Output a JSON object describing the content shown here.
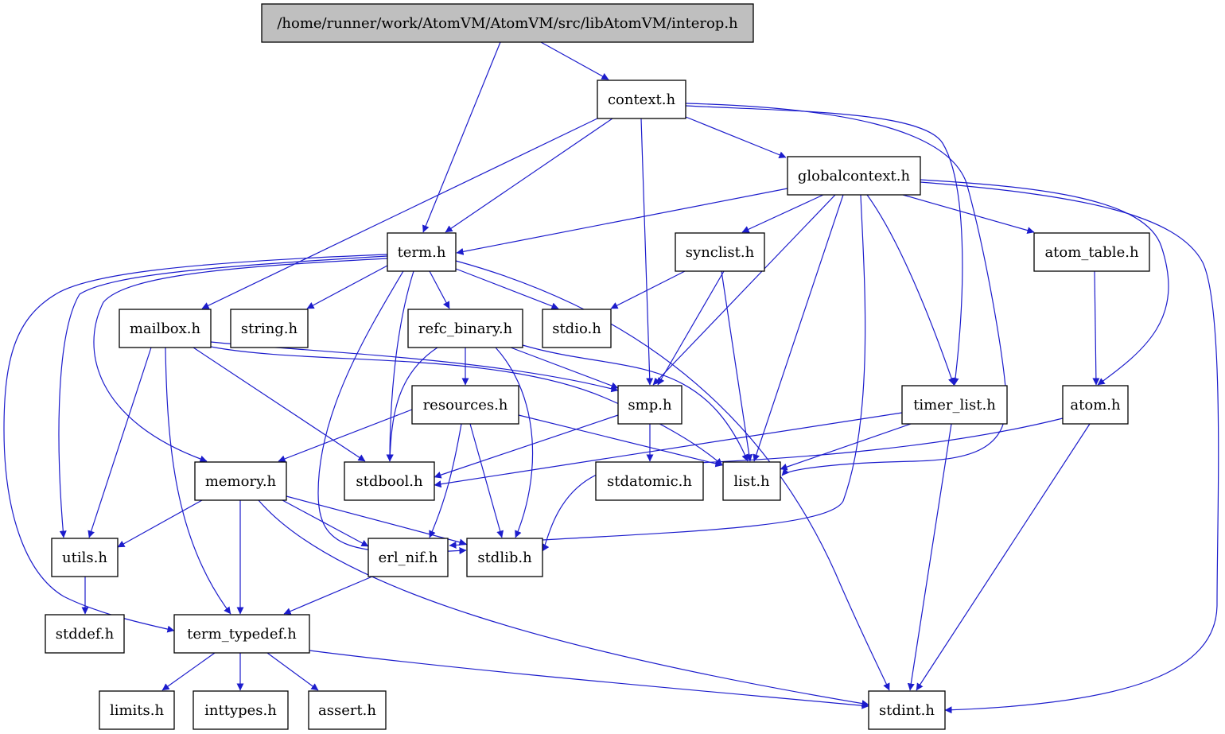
{
  "graph": {
    "type": "include-dependency-graph",
    "edge_color": "#1c1ccc",
    "root_fill": "#bfbfbf",
    "node_fill": "#ffffff",
    "nodes": [
      {
        "id": "interop",
        "label": "/home/runner/work/AtomVM/AtomVM/src/libAtomVM/interop.h",
        "root": true
      },
      {
        "id": "context",
        "label": "context.h"
      },
      {
        "id": "globalcontext",
        "label": "globalcontext.h"
      },
      {
        "id": "term",
        "label": "term.h"
      },
      {
        "id": "synclist",
        "label": "synclist.h"
      },
      {
        "id": "atom_table",
        "label": "atom_table.h"
      },
      {
        "id": "mailbox",
        "label": "mailbox.h"
      },
      {
        "id": "string",
        "label": "string.h"
      },
      {
        "id": "refc_binary",
        "label": "refc_binary.h"
      },
      {
        "id": "stdio",
        "label": "stdio.h"
      },
      {
        "id": "resources",
        "label": "resources.h"
      },
      {
        "id": "smp",
        "label": "smp.h"
      },
      {
        "id": "timer_list",
        "label": "timer_list.h"
      },
      {
        "id": "atom",
        "label": "atom.h"
      },
      {
        "id": "memory",
        "label": "memory.h"
      },
      {
        "id": "stdbool",
        "label": "stdbool.h"
      },
      {
        "id": "stdatomic",
        "label": "stdatomic.h"
      },
      {
        "id": "list",
        "label": "list.h"
      },
      {
        "id": "utils",
        "label": "utils.h"
      },
      {
        "id": "erl_nif",
        "label": "erl_nif.h"
      },
      {
        "id": "stdlib",
        "label": "stdlib.h"
      },
      {
        "id": "stddef",
        "label": "stddef.h"
      },
      {
        "id": "term_typedef",
        "label": "term_typedef.h"
      },
      {
        "id": "limits",
        "label": "limits.h"
      },
      {
        "id": "inttypes",
        "label": "inttypes.h"
      },
      {
        "id": "assert",
        "label": "assert.h"
      },
      {
        "id": "stdint",
        "label": "stdint.h"
      }
    ],
    "edges": [
      [
        "interop",
        "context"
      ],
      [
        "interop",
        "term"
      ],
      [
        "context",
        "globalcontext"
      ],
      [
        "context",
        "term"
      ],
      [
        "context",
        "mailbox"
      ],
      [
        "context",
        "smp"
      ],
      [
        "context",
        "timer_list"
      ],
      [
        "context",
        "list"
      ],
      [
        "globalcontext",
        "term"
      ],
      [
        "globalcontext",
        "synclist"
      ],
      [
        "globalcontext",
        "atom_table"
      ],
      [
        "globalcontext",
        "smp"
      ],
      [
        "globalcontext",
        "list"
      ],
      [
        "globalcontext",
        "erl_nif"
      ],
      [
        "globalcontext",
        "timer_list"
      ],
      [
        "globalcontext",
        "atom"
      ],
      [
        "globalcontext",
        "stdint"
      ],
      [
        "term",
        "string"
      ],
      [
        "term",
        "refc_binary"
      ],
      [
        "term",
        "stdio"
      ],
      [
        "term",
        "stdbool"
      ],
      [
        "term",
        "stdlib"
      ],
      [
        "term",
        "stdint"
      ],
      [
        "term",
        "memory"
      ],
      [
        "term",
        "utils"
      ],
      [
        "term",
        "term_typedef"
      ],
      [
        "synclist",
        "stdio"
      ],
      [
        "synclist",
        "smp"
      ],
      [
        "synclist",
        "list"
      ],
      [
        "atom_table",
        "atom"
      ],
      [
        "mailbox",
        "smp"
      ],
      [
        "mailbox",
        "list"
      ],
      [
        "mailbox",
        "stdbool"
      ],
      [
        "mailbox",
        "utils"
      ],
      [
        "mailbox",
        "term_typedef"
      ],
      [
        "refc_binary",
        "resources"
      ],
      [
        "refc_binary",
        "smp"
      ],
      [
        "refc_binary",
        "list"
      ],
      [
        "refc_binary",
        "stdbool"
      ],
      [
        "refc_binary",
        "stdlib"
      ],
      [
        "resources",
        "memory"
      ],
      [
        "resources",
        "list"
      ],
      [
        "resources",
        "erl_nif"
      ],
      [
        "resources",
        "stdlib"
      ],
      [
        "smp",
        "stdatomic"
      ],
      [
        "smp",
        "stdbool"
      ],
      [
        "timer_list",
        "list"
      ],
      [
        "timer_list",
        "stdbool"
      ],
      [
        "timer_list",
        "stdint"
      ],
      [
        "atom",
        "stdlib"
      ],
      [
        "atom",
        "stdint"
      ],
      [
        "memory",
        "utils"
      ],
      [
        "memory",
        "term_typedef"
      ],
      [
        "memory",
        "erl_nif"
      ],
      [
        "memory",
        "stdlib"
      ],
      [
        "memory",
        "stdint"
      ],
      [
        "utils",
        "stddef"
      ],
      [
        "erl_nif",
        "term_typedef"
      ],
      [
        "term_typedef",
        "limits"
      ],
      [
        "term_typedef",
        "inttypes"
      ],
      [
        "term_typedef",
        "assert"
      ],
      [
        "term_typedef",
        "stdint"
      ]
    ]
  }
}
